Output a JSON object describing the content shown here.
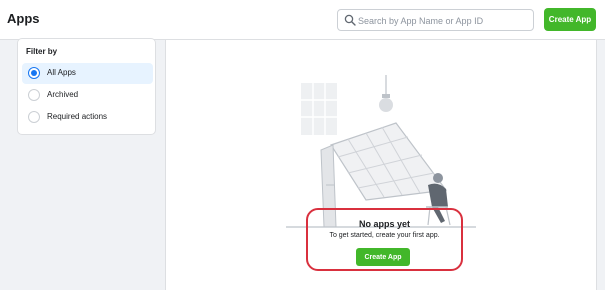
{
  "header": {
    "title": "Apps",
    "search_placeholder": "Search by App Name or App ID",
    "search_value": "",
    "create_label": "Create App"
  },
  "filter": {
    "title": "Filter by",
    "options": [
      {
        "label": "All Apps",
        "selected": true
      },
      {
        "label": "Archived",
        "selected": false
      },
      {
        "label": "Required actions",
        "selected": false
      }
    ]
  },
  "empty_state": {
    "title": "No apps yet",
    "subtitle": "To get started, create your first app.",
    "create_label": "Create App"
  },
  "colors": {
    "accent_green": "#42b72a",
    "selection_blue": "#1877f2",
    "highlight_red": "#d9303e"
  }
}
